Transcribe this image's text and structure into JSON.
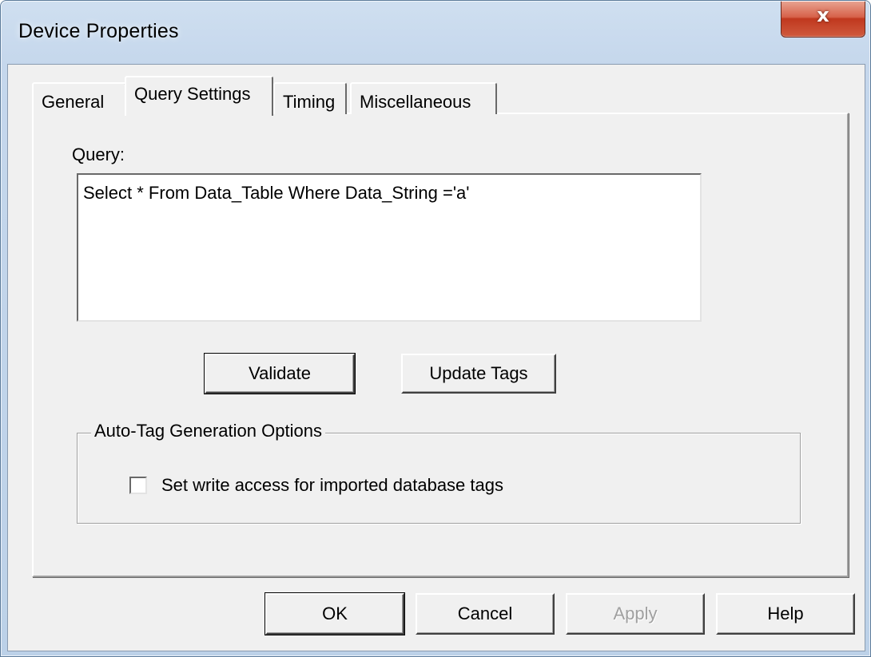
{
  "window": {
    "title": "Device Properties",
    "close_glyph": "x"
  },
  "tabs": [
    {
      "label": "General",
      "active": false
    },
    {
      "label": "Query Settings",
      "active": true
    },
    {
      "label": "Timing",
      "active": false
    },
    {
      "label": "Miscellaneous",
      "active": false
    }
  ],
  "query": {
    "label": "Query:",
    "value": "Select * From Data_Table Where Data_String ='a'"
  },
  "actions": {
    "validate_label": "Validate",
    "update_tags_label": "Update Tags"
  },
  "auto_tag": {
    "group_label": "Auto-Tag Generation Options",
    "checkbox_label": "Set write access for imported database tags",
    "checked": false
  },
  "footer": {
    "ok_label": "OK",
    "cancel_label": "Cancel",
    "apply_label": "Apply",
    "apply_enabled": false,
    "help_label": "Help"
  }
}
